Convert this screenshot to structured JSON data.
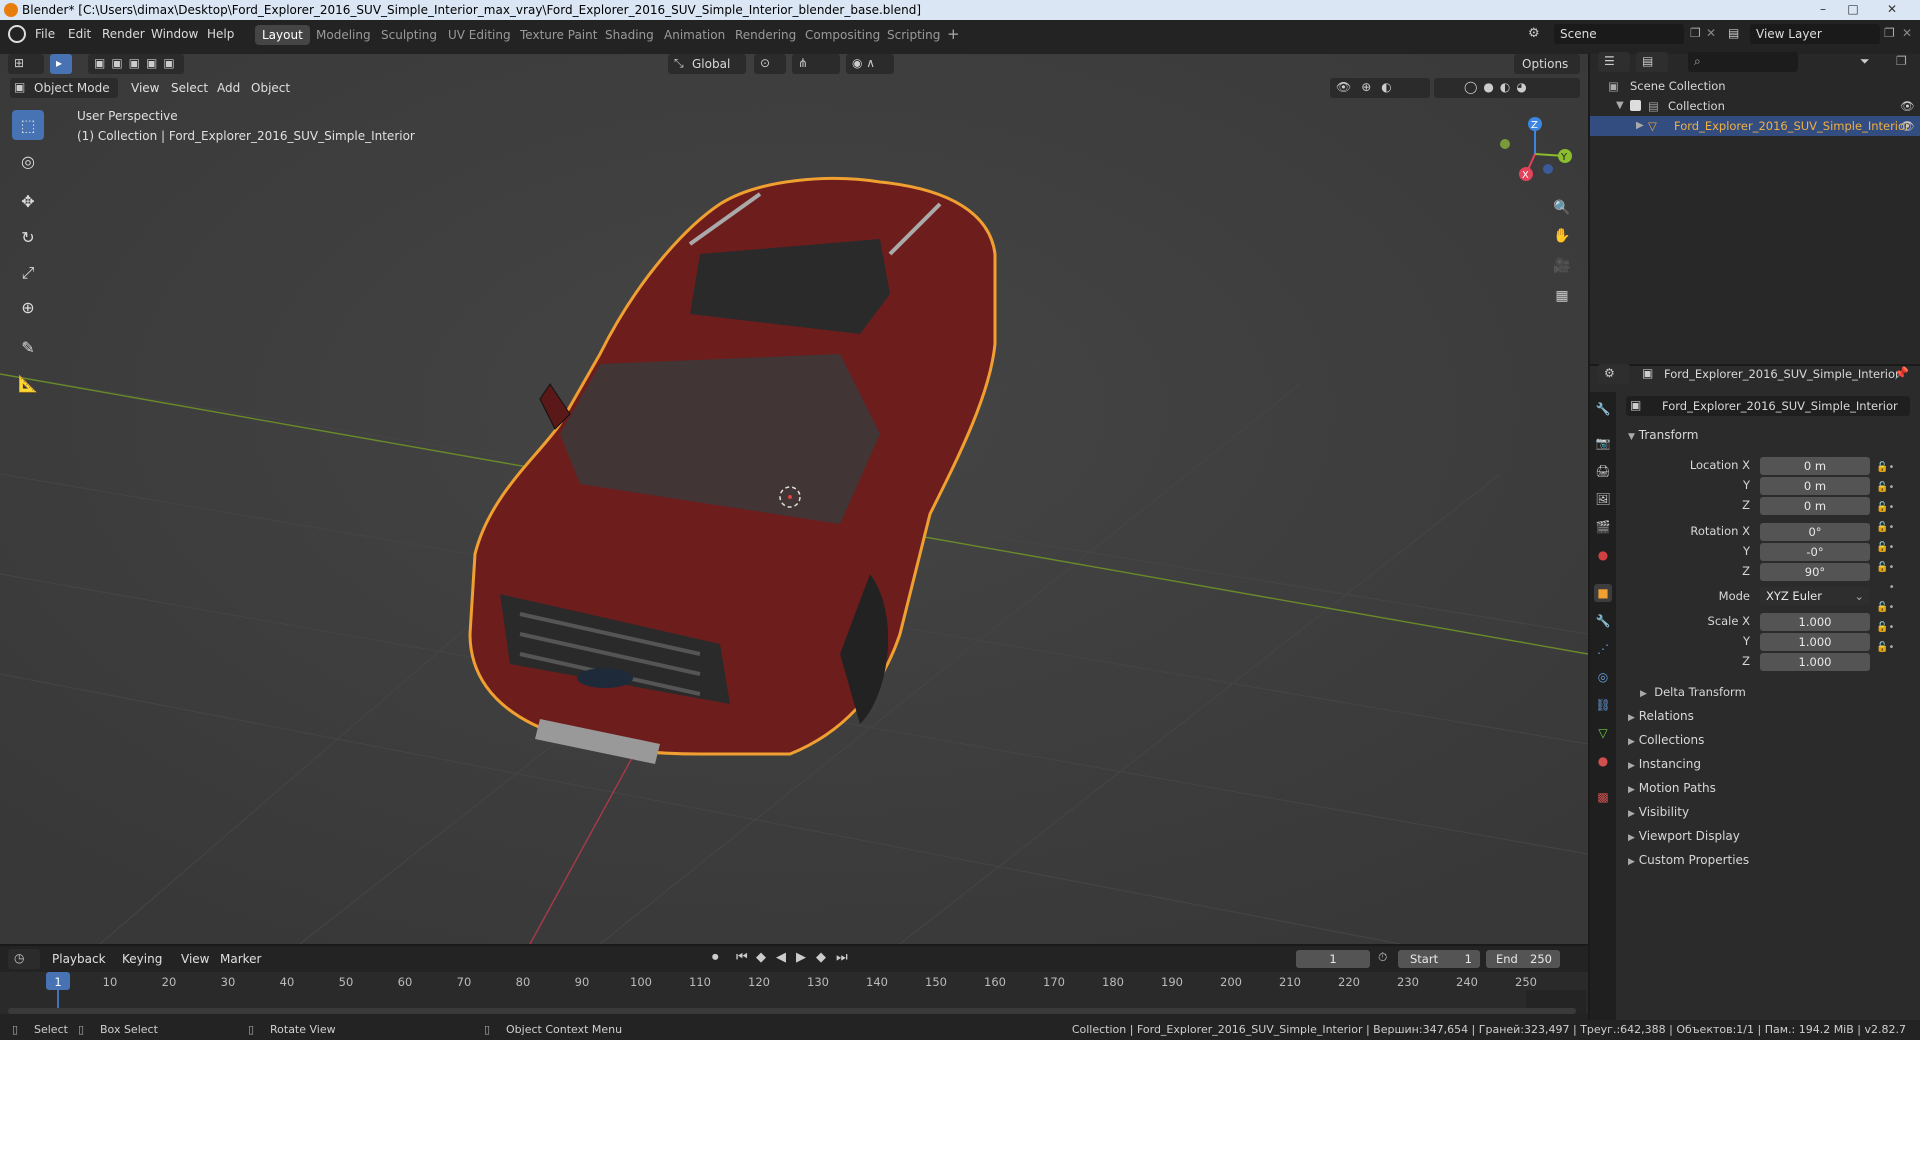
{
  "window": {
    "title": "Blender* [C:\\Users\\dimax\\Desktop\\Ford_Explorer_2016_SUV_Simple_Interior_max_vray\\Ford_Explorer_2016_SUV_Simple_Interior_blender_base.blend]"
  },
  "menu": [
    "File",
    "Edit",
    "Render",
    "Window",
    "Help"
  ],
  "workspaces": [
    "Layout",
    "Modeling",
    "Sculpting",
    "UV Editing",
    "Texture Paint",
    "Shading",
    "Animation",
    "Rendering",
    "Compositing",
    "Scripting"
  ],
  "active_workspace": "Layout",
  "scene_name": "Scene",
  "view_layer": "View Layer",
  "viewport": {
    "mode": "Object Mode",
    "menus": [
      "View",
      "Select",
      "Add",
      "Object"
    ],
    "transform_orientation": "Global",
    "options_label": "Options",
    "overlay_line1": "User Perspective",
    "overlay_line2": "(1) Collection | Ford_Explorer_2016_SUV_Simple_Interior",
    "gizmo_axes": {
      "x": "X",
      "y": "Y",
      "z": "Z"
    },
    "colors": {
      "x": "#e2425a",
      "y": "#8bbd2d",
      "z": "#3c86e2",
      "car": "#6e1d1d",
      "outline": "#f0a030"
    }
  },
  "outliner": {
    "root": "Scene Collection",
    "collection": "Collection",
    "object": "Ford_Explorer_2016_SUV_Simple_Interior"
  },
  "properties": {
    "object_header": "Ford_Explorer_2016_SUV_Simple_Interior",
    "object_name": "Ford_Explorer_2016_SUV_Simple_Interior",
    "transform_label": "Transform",
    "location_label": "Location X",
    "rotation_label": "Rotation X",
    "scale_label": "Scale X",
    "y_label": "Y",
    "z_label": "Z",
    "mode_label": "Mode",
    "location": [
      "0 m",
      "0 m",
      "0 m"
    ],
    "rotation": [
      "0°",
      "-0°",
      "90°"
    ],
    "rotation_mode": "XYZ Euler",
    "scale": [
      "1.000",
      "1.000",
      "1.000"
    ],
    "delta_transform": "Delta Transform",
    "panels": [
      "Relations",
      "Collections",
      "Instancing",
      "Motion Paths",
      "Visibility",
      "Viewport Display",
      "Custom Properties"
    ]
  },
  "timeline": {
    "menus": [
      "Playback",
      "Keying",
      "View",
      "Marker"
    ],
    "current_frame": "1",
    "start_label": "Start",
    "start": "1",
    "end_label": "End",
    "end": "250",
    "ticks": [
      "1",
      "10",
      "20",
      "30",
      "40",
      "50",
      "60",
      "70",
      "80",
      "90",
      "100",
      "110",
      "120",
      "130",
      "140",
      "150",
      "160",
      "170",
      "180",
      "190",
      "200",
      "210",
      "220",
      "230",
      "240",
      "250"
    ]
  },
  "statusbar": {
    "select": "Select",
    "box_select": "Box Select",
    "rotate_view": "Rotate View",
    "context_menu": "Object Context Menu",
    "stats": "Collection | Ford_Explorer_2016_SUV_Simple_Interior | Вершин:347,654 | Граней:323,497 | Треуг.:642,388 | Объектов:1/1 | Пам.: 194.2 MiB | v2.82.7"
  }
}
